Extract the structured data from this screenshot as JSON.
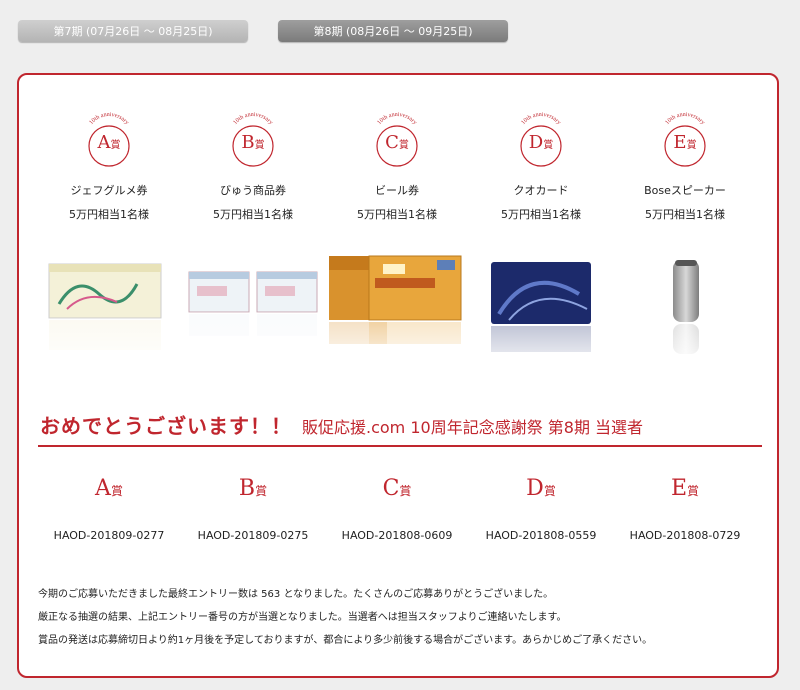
{
  "tabs": [
    {
      "label": "第7期 (07月26日 ～ 08月25日)"
    },
    {
      "label": "第8期 (08月26日 ～ 09月25日)"
    }
  ],
  "seal_arc_text": "10th anniversary",
  "seal_suffix": "賞",
  "prizes": [
    {
      "letter": "A",
      "name": "ジェフグルメ券",
      "value": "5万円相当1名様"
    },
    {
      "letter": "B",
      "name": "びゅう商品券",
      "value": "5万円相当1名様"
    },
    {
      "letter": "C",
      "name": "ビール券",
      "value": "5万円相当1名様"
    },
    {
      "letter": "D",
      "name": "クオカード",
      "value": "5万円相当1名様"
    },
    {
      "letter": "E",
      "name": "Boseスピーカー",
      "value": "5万円相当1名様"
    }
  ],
  "winners": {
    "title_main": "おめでとうございます！！",
    "title_sub": "販促応援.com 10周年記念感謝祭 第8期 当選者",
    "entries": [
      {
        "letter": "A",
        "id": "HAOD-201809-0277"
      },
      {
        "letter": "B",
        "id": "HAOD-201809-0275"
      },
      {
        "letter": "C",
        "id": "HAOD-201808-0609"
      },
      {
        "letter": "D",
        "id": "HAOD-201808-0559"
      },
      {
        "letter": "E",
        "id": "HAOD-201808-0729"
      }
    ]
  },
  "notes": [
    "今期のご応募いただきました最終エントリー数は 563 となりました。たくさんのご応募ありがとうございました。",
    "厳正なる抽選の結果、上記エントリー番号の方が当選となりました。当選者へは担当スタッフよりご連絡いたします。",
    "賞品の発送は応募締切日より約1ヶ月後を予定しておりますが、都合により多少前後する場合がございます。あらかじめご了承ください。"
  ],
  "colors": {
    "accent": "#c0262e"
  }
}
